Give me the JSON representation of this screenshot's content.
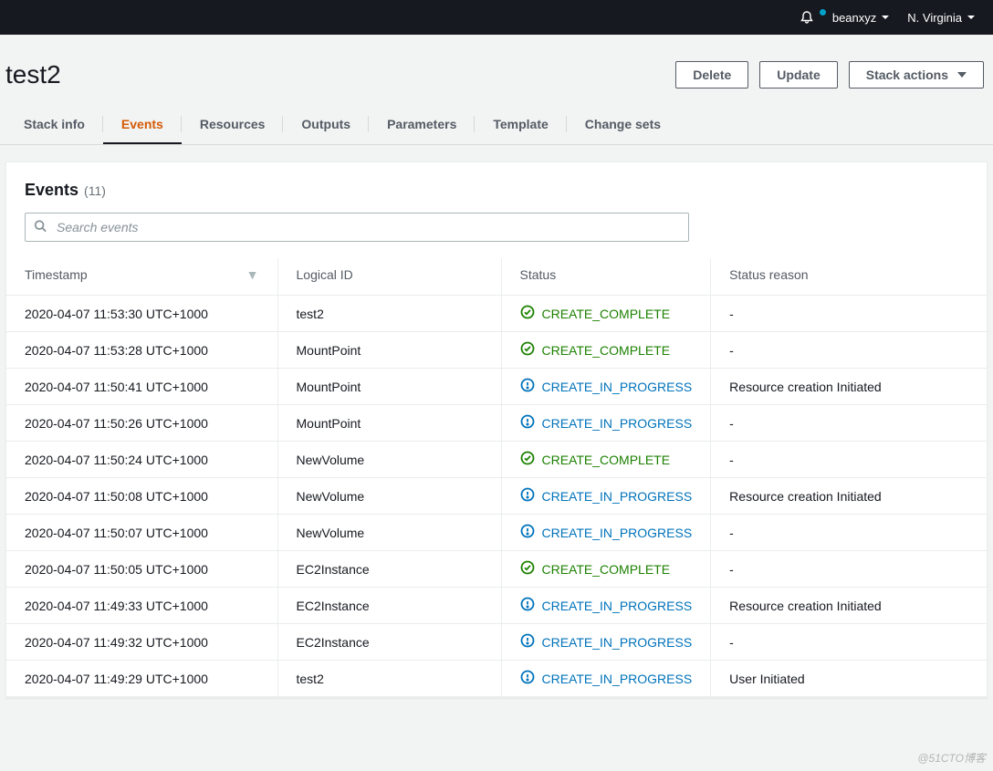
{
  "topnav": {
    "username": "beanxyz",
    "region": "N. Virginia"
  },
  "page": {
    "title": "test2"
  },
  "buttons": {
    "delete": "Delete",
    "update": "Update",
    "stack_actions": "Stack actions"
  },
  "tabs": [
    {
      "label": "Stack info",
      "name": "stack-info",
      "active": false
    },
    {
      "label": "Events",
      "name": "events",
      "active": true
    },
    {
      "label": "Resources",
      "name": "resources",
      "active": false
    },
    {
      "label": "Outputs",
      "name": "outputs",
      "active": false
    },
    {
      "label": "Parameters",
      "name": "parameters",
      "active": false
    },
    {
      "label": "Template",
      "name": "template",
      "active": false
    },
    {
      "label": "Change sets",
      "name": "change-sets",
      "active": false
    }
  ],
  "panel": {
    "title": "Events",
    "count": "(11)"
  },
  "search": {
    "placeholder": "Search events",
    "value": ""
  },
  "columns": {
    "timestamp": "Timestamp",
    "logical_id": "Logical ID",
    "status": "Status",
    "status_reason": "Status reason"
  },
  "status_labels": {
    "complete": "CREATE_COMPLETE",
    "in_progress": "CREATE_IN_PROGRESS"
  },
  "events": [
    {
      "ts": "2020-04-07 11:53:30 UTC+1000",
      "logical": "test2",
      "status": "complete",
      "reason": "-"
    },
    {
      "ts": "2020-04-07 11:53:28 UTC+1000",
      "logical": "MountPoint",
      "status": "complete",
      "reason": "-"
    },
    {
      "ts": "2020-04-07 11:50:41 UTC+1000",
      "logical": "MountPoint",
      "status": "in_progress",
      "reason": "Resource creation Initiated"
    },
    {
      "ts": "2020-04-07 11:50:26 UTC+1000",
      "logical": "MountPoint",
      "status": "in_progress",
      "reason": "-"
    },
    {
      "ts": "2020-04-07 11:50:24 UTC+1000",
      "logical": "NewVolume",
      "status": "complete",
      "reason": "-"
    },
    {
      "ts": "2020-04-07 11:50:08 UTC+1000",
      "logical": "NewVolume",
      "status": "in_progress",
      "reason": "Resource creation Initiated"
    },
    {
      "ts": "2020-04-07 11:50:07 UTC+1000",
      "logical": "NewVolume",
      "status": "in_progress",
      "reason": "-"
    },
    {
      "ts": "2020-04-07 11:50:05 UTC+1000",
      "logical": "EC2Instance",
      "status": "complete",
      "reason": "-"
    },
    {
      "ts": "2020-04-07 11:49:33 UTC+1000",
      "logical": "EC2Instance",
      "status": "in_progress",
      "reason": "Resource creation Initiated"
    },
    {
      "ts": "2020-04-07 11:49:32 UTC+1000",
      "logical": "EC2Instance",
      "status": "in_progress",
      "reason": "-"
    },
    {
      "ts": "2020-04-07 11:49:29 UTC+1000",
      "logical": "test2",
      "status": "in_progress",
      "reason": "User Initiated"
    }
  ],
  "watermark": "@51CTO博客"
}
